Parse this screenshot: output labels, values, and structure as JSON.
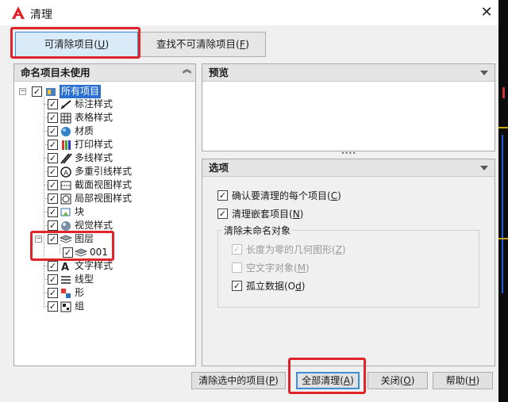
{
  "window": {
    "title": "清理",
    "close_glyph": "✕"
  },
  "tabs": [
    {
      "label": "可清除项目(",
      "key": "U",
      "suffix": ")"
    },
    {
      "label": "查找不可清除项目(",
      "key": "F",
      "suffix": ")"
    }
  ],
  "left_panel": {
    "header": "命名项目未使用",
    "items": [
      {
        "label": "所有项目",
        "checked": true,
        "icon": "all-items-icon",
        "expander": "−"
      },
      {
        "label": "标注样式",
        "checked": true,
        "icon": "dimension-style-icon"
      },
      {
        "label": "表格样式",
        "checked": true,
        "icon": "table-style-icon"
      },
      {
        "label": "材质",
        "checked": true,
        "icon": "material-icon"
      },
      {
        "label": "打印样式",
        "checked": true,
        "icon": "plot-style-icon"
      },
      {
        "label": "多线样式",
        "checked": true,
        "icon": "multiline-style-icon"
      },
      {
        "label": "多重引线样式",
        "checked": true,
        "icon": "mleader-style-icon"
      },
      {
        "label": "截面视图样式",
        "checked": true,
        "icon": "section-view-icon"
      },
      {
        "label": "局部视图样式",
        "checked": true,
        "icon": "detail-view-icon"
      },
      {
        "label": "块",
        "checked": true,
        "icon": "block-icon"
      },
      {
        "label": "视觉样式",
        "checked": true,
        "icon": "visual-style-icon"
      },
      {
        "label": "图层",
        "checked": true,
        "icon": "layer-icon",
        "expander": "−"
      },
      {
        "label": "001",
        "checked": true,
        "icon": "layer-icon"
      },
      {
        "label": "文字样式",
        "checked": true,
        "icon": "text-style-icon"
      },
      {
        "label": "线型",
        "checked": true,
        "icon": "linetype-icon"
      },
      {
        "label": "形",
        "checked": true,
        "icon": "shape-icon"
      },
      {
        "label": "组",
        "checked": true,
        "icon": "group-icon"
      }
    ]
  },
  "preview_panel": {
    "header": "预览"
  },
  "options_panel": {
    "header": "选项",
    "confirm": {
      "label": "确认要清理的每个项目(",
      "key": "C",
      "suffix": ")",
      "checked": true
    },
    "nested": {
      "label": "清理嵌套项目(",
      "key": "N",
      "suffix": ")",
      "checked": true
    },
    "unnamed_group": {
      "title": "清除未命名对象",
      "zero_length": {
        "label": "长度为零的几何图形(",
        "key": "Z",
        "suffix": ")",
        "checked": true,
        "disabled": true
      },
      "empty_text": {
        "label": "空文字对象(",
        "key": "M",
        "suffix": ")",
        "checked": false,
        "disabled": true
      },
      "orphan": {
        "label": "孤立数据(O",
        "key": "d",
        "suffix": ")",
        "checked": true,
        "disabled": false
      }
    }
  },
  "buttons": {
    "purge_checked": {
      "label": "清除选中的项目(",
      "key": "P",
      "suffix": ")"
    },
    "purge_all": {
      "label": "全部清理(",
      "key": "A",
      "suffix": ")"
    },
    "close": {
      "label": "关闭(",
      "key": "O",
      "suffix": ")"
    },
    "help": {
      "label": "帮助(",
      "key": "H",
      "suffix": ")"
    }
  },
  "colors": {
    "accent": "#3c8fd6",
    "highlight_box": "#e0242c",
    "selection": "#2b6fd1"
  }
}
